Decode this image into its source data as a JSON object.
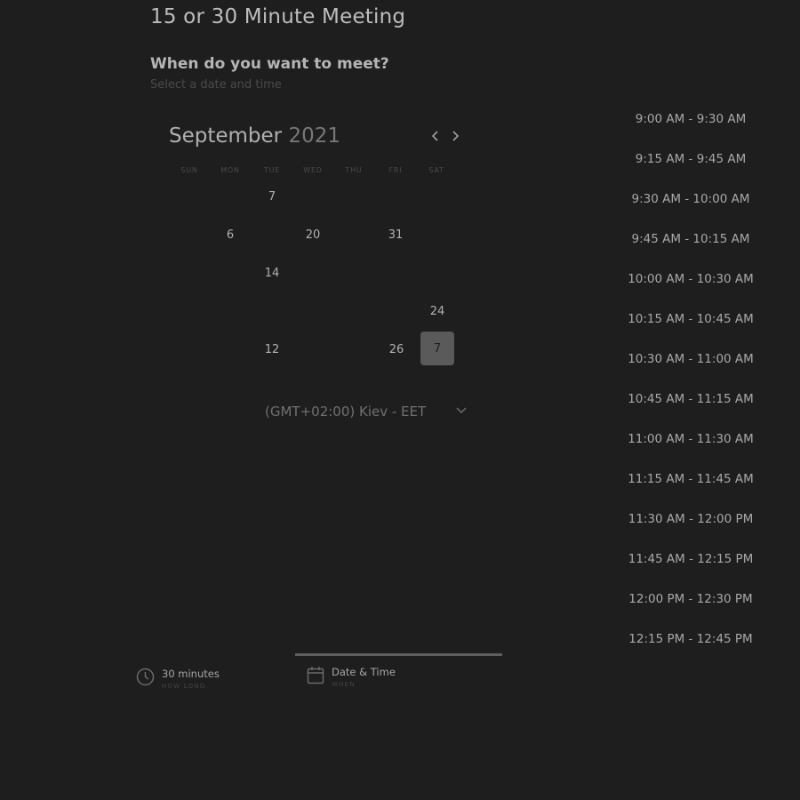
{
  "header": {
    "title": "15 or 30 Minute Meeting",
    "question": "When do you want to meet?",
    "subtitle": "Select a date and time"
  },
  "calendar": {
    "month": "September",
    "year": "2021",
    "weekdays": [
      "SUN",
      "MON",
      "TUE",
      "WED",
      "THU",
      "FRI",
      "SAT"
    ],
    "visible_days": [
      "7",
      "6",
      "20",
      "31",
      "14",
      "24",
      "12",
      "26",
      "7"
    ],
    "selected_day": "7"
  },
  "timezone": {
    "label": "(GMT+02:00) Kiev - EET"
  },
  "time_slots": [
    "9:00 AM - 9:30 AM",
    "9:15 AM - 9:45 AM",
    "9:30 AM - 10:00 AM",
    "9:45 AM - 10:15 AM",
    "10:00 AM - 10:30 AM",
    "10:15 AM - 10:45 AM",
    "10:30 AM - 11:00 AM",
    "10:45 AM - 11:15 AM",
    "11:00 AM - 11:30 AM",
    "11:15 AM - 11:45 AM",
    "11:30 AM - 12:00 PM",
    "11:45 AM - 12:15 PM",
    "12:00 PM - 12:30 PM",
    "12:15 PM - 12:45 PM"
  ],
  "steps": {
    "duration": {
      "label": "30 minutes",
      "sub": "HOW LONG"
    },
    "when": {
      "label": "Date & Time",
      "sub": "WHEN"
    }
  }
}
